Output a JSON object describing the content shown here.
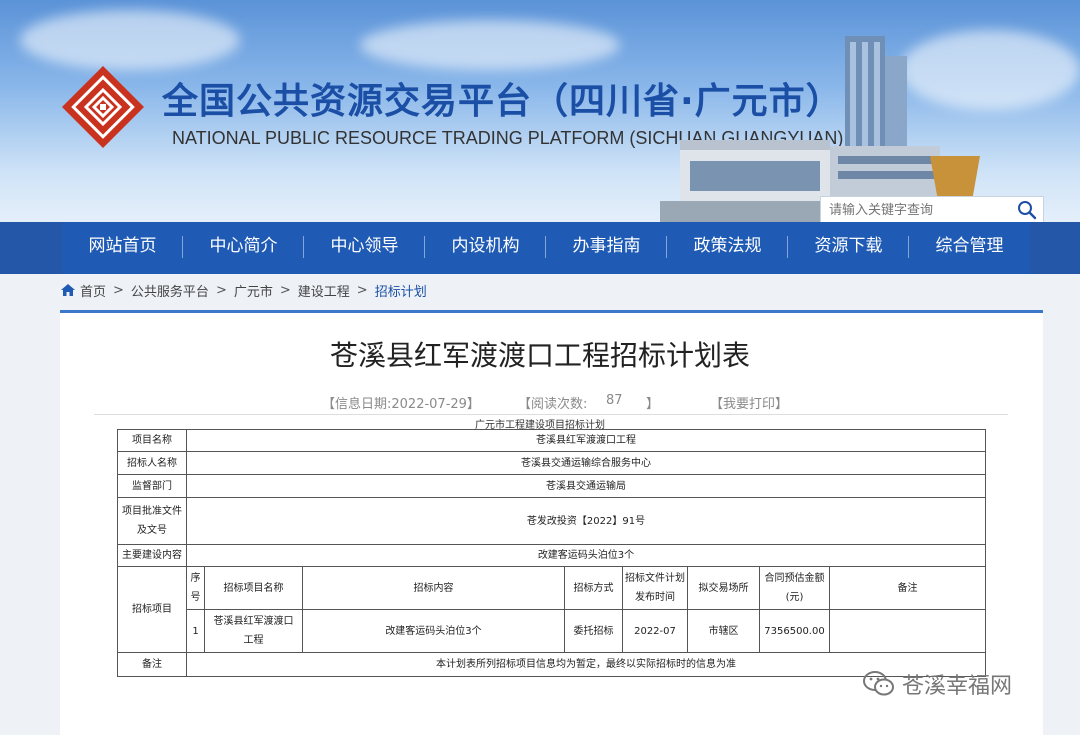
{
  "header": {
    "title_cn": "全国公共资源交易平台（四川省·广元市）",
    "title_en": "NATIONAL PUBLIC RESOURCE TRADING PLATFORM (SICHUAN,GUANGYUAN)",
    "search_placeholder": "请输入关键字查询",
    "logo_icon": "diamond-logo-icon",
    "accent_color": "#1b4fa6"
  },
  "nav": {
    "items": [
      "网站首页",
      "中心简介",
      "中心领导",
      "内设机构",
      "办事指南",
      "政策法规",
      "资源下载",
      "综合管理"
    ]
  },
  "breadcrumb": {
    "home": "首页",
    "items": [
      "公共服务平台",
      "广元市",
      "建设工程",
      "招标计划"
    ]
  },
  "article": {
    "title": "苍溪县红军渡渡口工程招标计划表",
    "info_date": "【信息日期:2022-07-29】",
    "read_label": "【阅读次数:",
    "read_count": "87",
    "read_close": "】",
    "print": "【我要打印】"
  },
  "table": {
    "caption": "广元市工程建设项目招标计划",
    "project_name_label": "项目名称",
    "project_name": "苍溪县红军渡渡口工程",
    "tenderer_label": "招标人名称",
    "tenderer": "苍溪县交通运输综合服务中心",
    "supervisor_label": "监督部门",
    "supervisor": "苍溪县交通运输局",
    "approval_label_1": "项目批准文件",
    "approval_label_2": "及文号",
    "approval": "苍发改投资【2022】91号",
    "content_label": "主要建设内容",
    "content": "改建客运码头泊位3个",
    "bid_label": "招标项目",
    "headers": {
      "no_1": "序",
      "no_2": "号",
      "name": "招标项目名称",
      "content": "招标内容",
      "method": "招标方式",
      "time_1": "招标文件计划",
      "time_2": "发布时间",
      "place": "拟交易场所",
      "amount_1": "合同预估金额",
      "amount_2": "(元)",
      "remark": "备注"
    },
    "row": {
      "no": "1",
      "name_1": "苍溪县红军渡渡口",
      "name_2": "工程",
      "content": "改建客运码头泊位3个",
      "method": "委托招标",
      "time": "2022-07",
      "place": "市辖区",
      "amount": "7356500.00",
      "remark": ""
    },
    "note_label": "备注",
    "note": "本计划表所列招标项目信息均为暂定，最终以实际招标时的信息为准"
  },
  "watermark": {
    "text": "苍溪幸福网",
    "icon": "wechat-icon"
  }
}
